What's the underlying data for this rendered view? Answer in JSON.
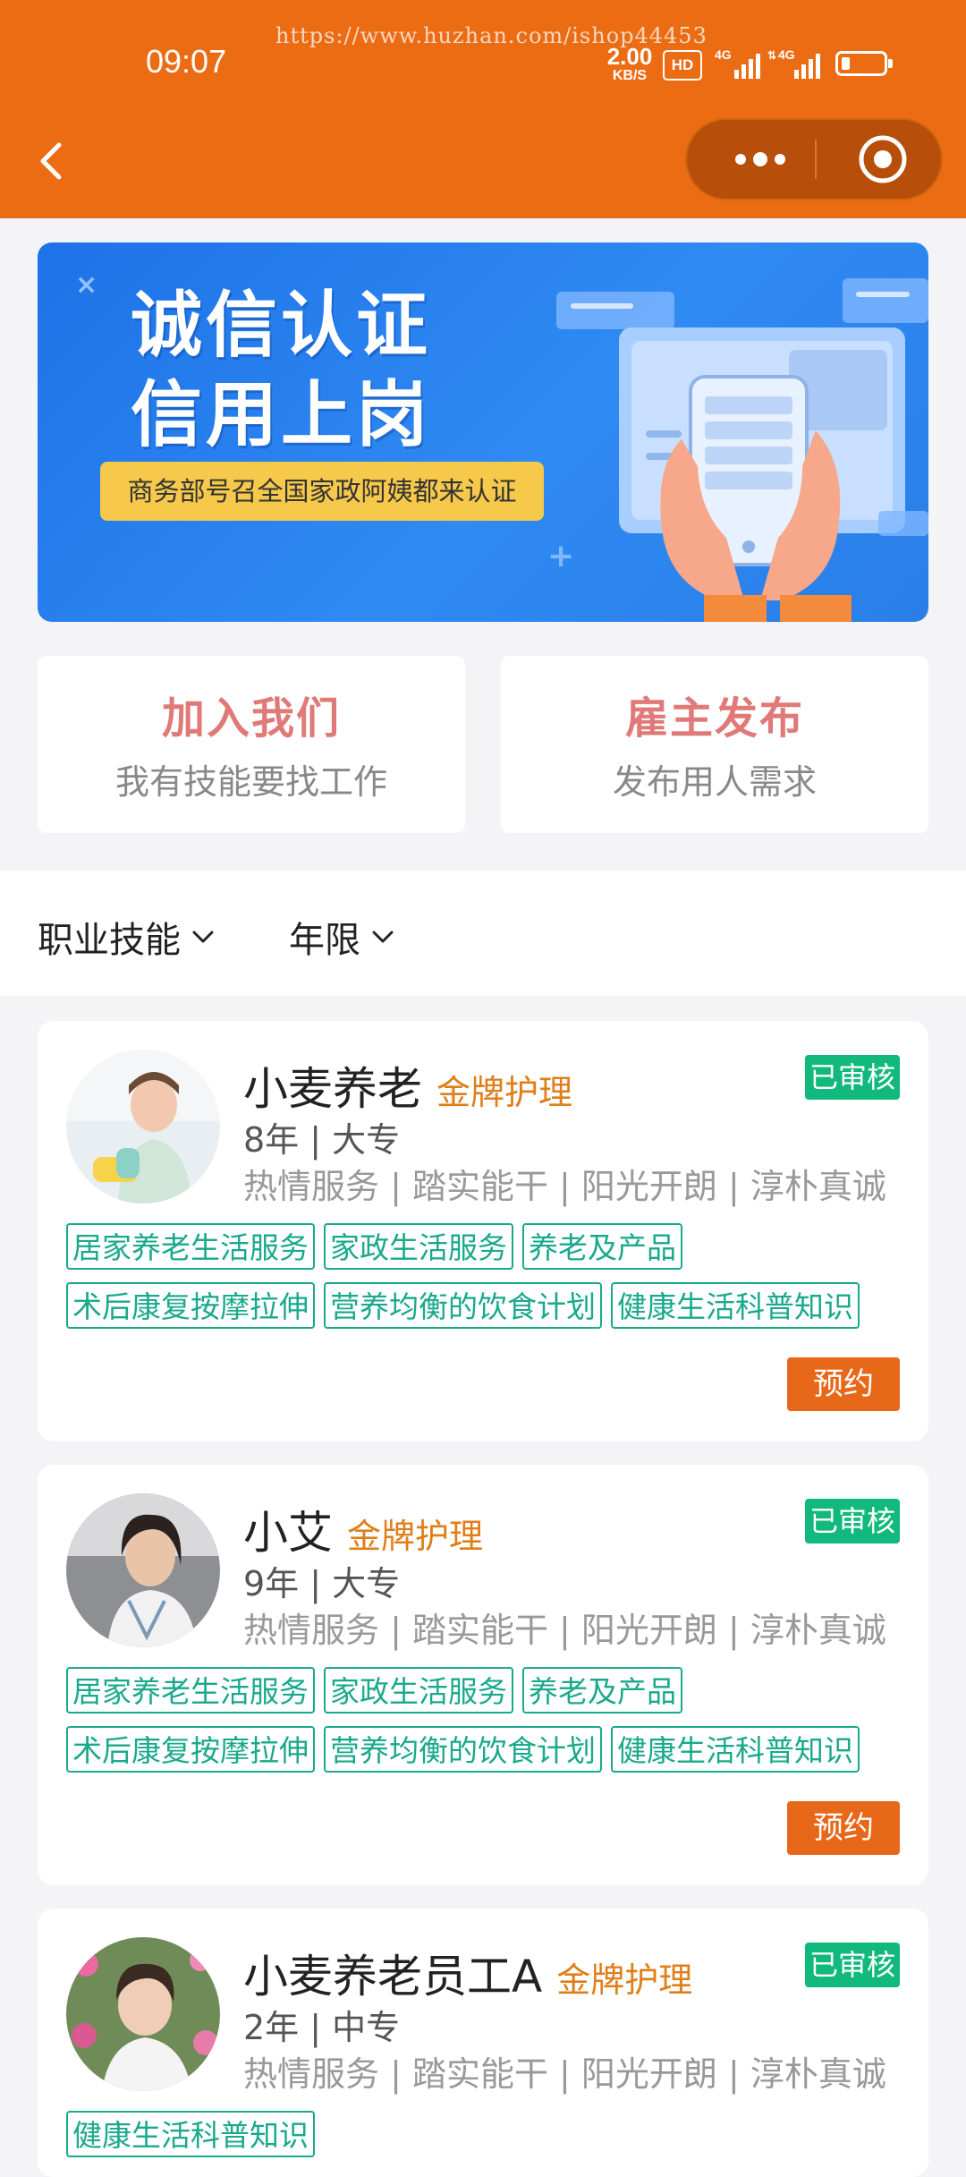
{
  "status_bar": {
    "time": "09:07",
    "watermark": "https://www.huzhan.com/ishop44453",
    "net_speed_value": "2.00",
    "net_speed_unit": "KB/S",
    "hd_badge": "HD",
    "signal_1_label": "4G",
    "signal_2_label": "4G",
    "battery_level": 0.2
  },
  "nav": {
    "back_icon": "chevron-left-icon",
    "more_icon": "more-dots-icon",
    "close_icon": "target-circle-icon"
  },
  "banner": {
    "title_line1": "诚信认证",
    "title_line2": "信用上岗",
    "tagline": "商务部号召全国家政阿姨都来认证"
  },
  "actions": {
    "join": {
      "title": "加入我们",
      "subtitle": "我有技能要找工作"
    },
    "employer": {
      "title": "雇主发布",
      "subtitle": "发布用人需求"
    }
  },
  "filters": {
    "skill": "职业技能",
    "years": "年限"
  },
  "colors": {
    "brand_orange": "#ec6c14",
    "verified_green": "#11b97d",
    "tag_green": "#19a98c",
    "medal_gold": "#e07e1a",
    "action_red": "#e07a78"
  },
  "caregivers": [
    {
      "name": "小麦养老",
      "level": "金牌护理",
      "status": "已审核",
      "meta": "8年 | 大专",
      "traits": "热情服务 | 踏实能干 | 阳光开朗 | 淳朴真诚",
      "tags": [
        "居家养老生活服务",
        "家政生活服务",
        "养老及产品",
        "术后康复按摩拉伸",
        "营养均衡的饮食计划",
        "健康生活科普知识"
      ],
      "book_label": "预约"
    },
    {
      "name": "小艾",
      "level": "金牌护理",
      "status": "已审核",
      "meta": "9年 | 大专",
      "traits": "热情服务 | 踏实能干 | 阳光开朗 | 淳朴真诚",
      "tags": [
        "居家养老生活服务",
        "家政生活服务",
        "养老及产品",
        "术后康复按摩拉伸",
        "营养均衡的饮食计划",
        "健康生活科普知识"
      ],
      "book_label": "预约"
    },
    {
      "name": "小麦养老员工A",
      "level": "金牌护理",
      "status": "已审核",
      "meta": "2年 | 中专",
      "traits": "热情服务 | 踏实能干 | 阳光开朗 | 淳朴真诚",
      "tags": [
        "健康生活科普知识"
      ],
      "book_label": ""
    }
  ]
}
